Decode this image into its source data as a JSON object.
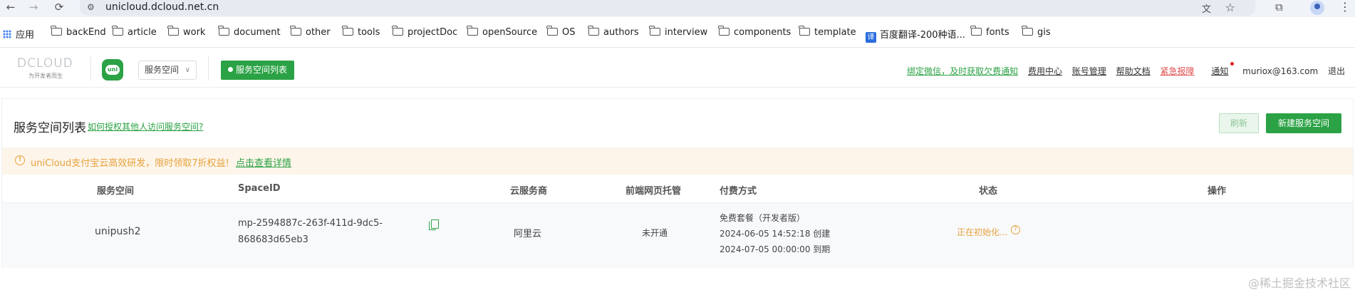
{
  "browser": {
    "url": "unicloud.dcloud.net.cn",
    "bookmarks": [
      "应用",
      "backEnd",
      "article",
      "work",
      "document",
      "other",
      "tools",
      "projectDoc",
      "openSource",
      "OS",
      "authors",
      "interview",
      "components",
      "template",
      "百度翻译-200种语...",
      "fonts",
      "gis"
    ]
  },
  "header": {
    "logo_text": "DCLOUD",
    "logo_sub": "为开发者而生",
    "uni_label": "uni",
    "space_select": "服务空间",
    "space_list_btn": "服务空间列表",
    "links": {
      "bind_wechat": "绑定微信，及时获取欠费通知",
      "billing": "费用中心",
      "account": "账号管理",
      "help": "帮助文档",
      "emergency": "紧急报障",
      "notice": "通知",
      "email": "muriox@163.com",
      "logout": "退出"
    }
  },
  "main": {
    "title": "服务空间列表",
    "help_link": "如何授权其他人访问服务空间?",
    "refresh_btn": "刷新",
    "new_btn": "新建服务空间",
    "banner_text": "uniCloud支付宝云高效研发，限时领取7折权益!",
    "banner_link": "点击查看详情",
    "columns": [
      "服务空间",
      "SpaceID",
      "云服务商",
      "前端网页托管",
      "付费方式",
      "状态",
      "操作"
    ],
    "row": {
      "name": "unipush2",
      "space_id_1": "mp-2594887c-263f-411d-9dc5-",
      "space_id_2": "868683d65eb3",
      "provider": "阿里云",
      "hosting": "未开通",
      "plan": "免费套餐（开发者版）",
      "created": "2024-06-05 14:52:18 创建",
      "expire": "2024-07-05 00:00:00 到期",
      "status": "正在初始化..."
    }
  },
  "watermark": "@稀土掘金技术社区",
  "colors": {
    "accent": "#2ba245",
    "warning": "#e6a23c",
    "danger": "#e04f4f"
  }
}
